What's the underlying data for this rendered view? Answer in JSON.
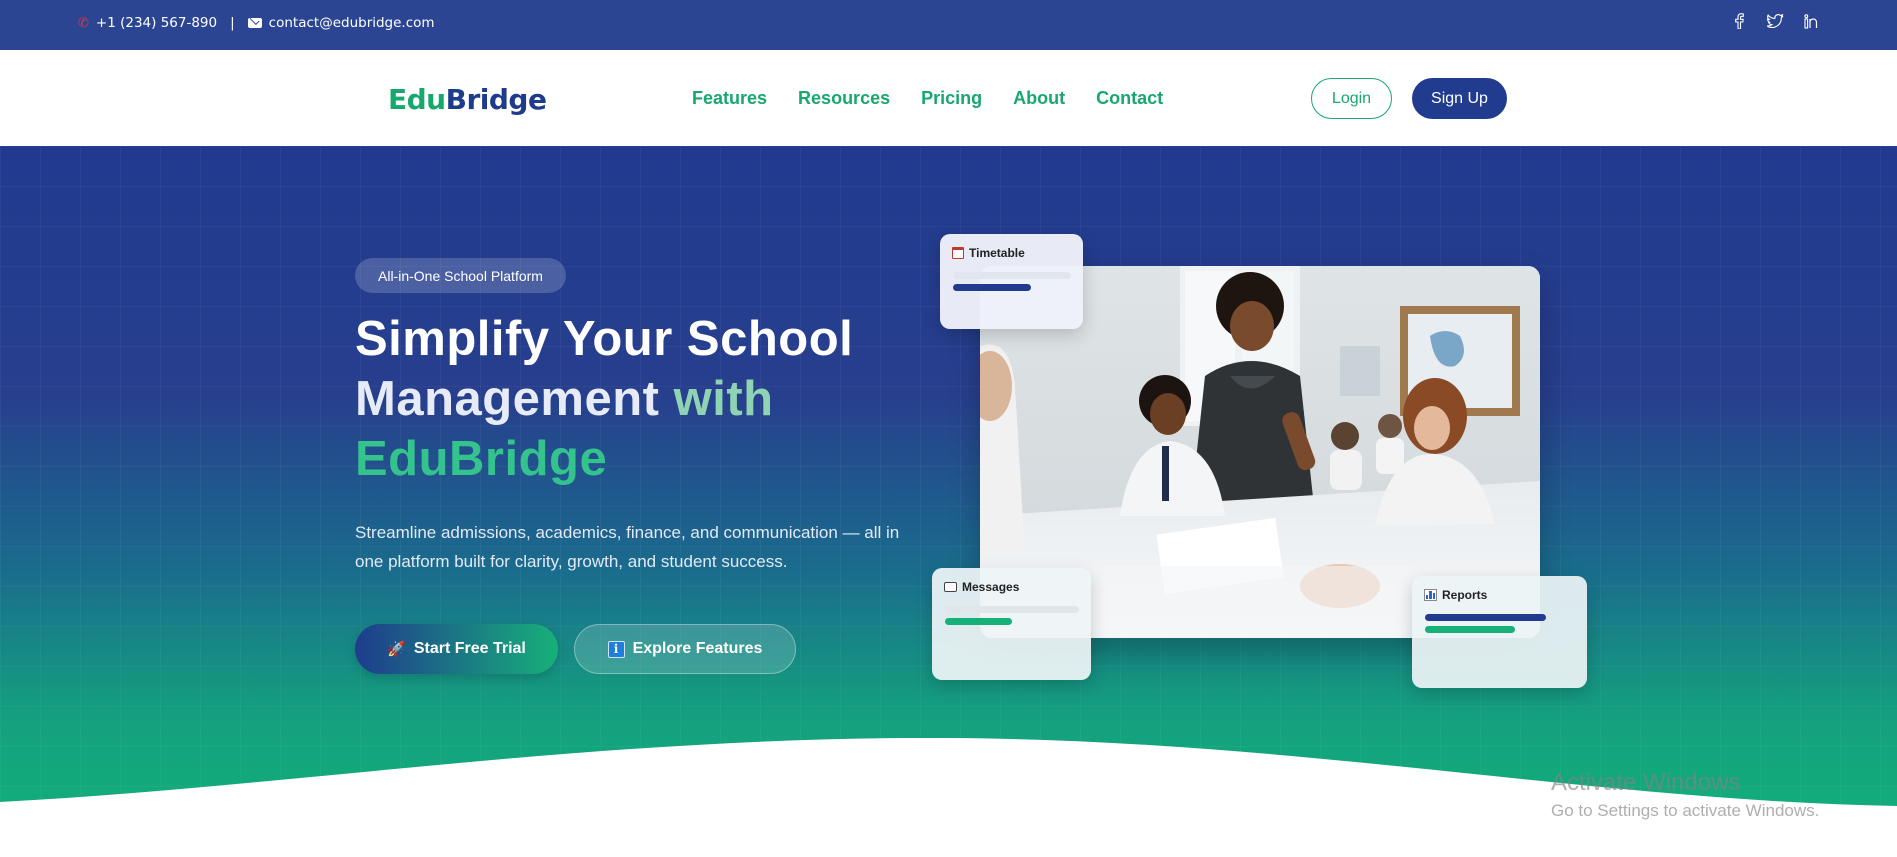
{
  "topbar": {
    "phone": "+1 (234) 567-890",
    "separator": "|",
    "email": "contact@edubridge.com",
    "social": [
      "facebook-icon",
      "twitter-icon",
      "linkedin-icon"
    ]
  },
  "brand": {
    "part1": "Edu",
    "part2": "Bridge"
  },
  "nav": {
    "links": [
      "Features",
      "Resources",
      "Pricing",
      "About",
      "Contact"
    ],
    "login_label": "Login",
    "signup_label": "Sign Up"
  },
  "hero": {
    "badge": "All-in-One School Platform",
    "headline_line1": "Simplify Your School",
    "headline_line2a": "Management ",
    "headline_line2b": "with",
    "headline_line3": "EduBridge",
    "subtext": "Streamline admissions, academics, finance, and communication — all in one platform built for clarity, growth, and student success.",
    "cta_primary": "Start Free Trial",
    "cta_secondary": "Explore Features",
    "cta_primary_icon": "rocket-icon",
    "cta_secondary_icon": "info-icon"
  },
  "cards": {
    "timetable": {
      "title": "Timetable",
      "icon": "calendar-icon"
    },
    "messages": {
      "title": "Messages",
      "icon": "chat-icon"
    },
    "reports": {
      "title": "Reports",
      "icon": "bar-chart-icon"
    }
  },
  "colors": {
    "primary_blue": "#213b8e",
    "primary_green": "#17a86e",
    "topbar": "#2b4593"
  },
  "watermark": {
    "line1": "Activate Windows",
    "line2": "Go to Settings to activate Windows."
  }
}
